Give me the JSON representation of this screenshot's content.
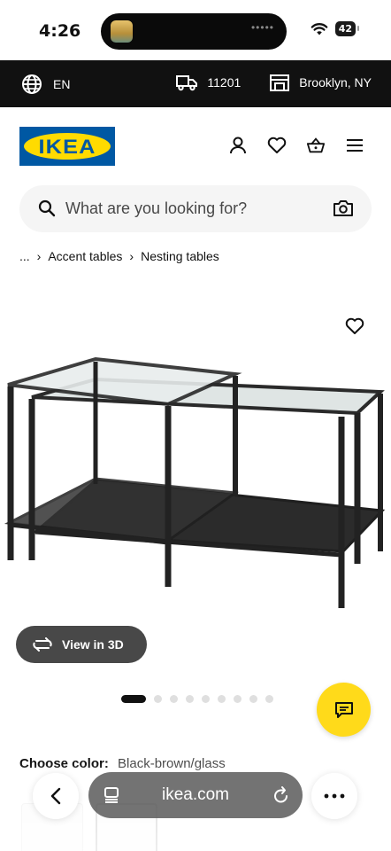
{
  "status_bar": {
    "time": "4:26",
    "battery": "42",
    "island_dots": "•••••"
  },
  "locale_bar": {
    "language": "EN",
    "zip": "11201",
    "store": "Brooklyn, NY"
  },
  "header": {
    "logo_text": "IKEA"
  },
  "search": {
    "placeholder": "What are you looking for?"
  },
  "breadcrumb": {
    "ellipsis": "...",
    "items": [
      "Accent tables",
      "Nesting tables"
    ]
  },
  "product": {
    "view_3d_label": "View in 3D",
    "image_count": 9,
    "active_image": 1
  },
  "color": {
    "label": "Choose color:",
    "value": "Black-brown/glass"
  },
  "browser": {
    "url": "ikea.com"
  },
  "colors": {
    "ikea_blue": "#0058a3",
    "ikea_yellow": "#ffdb00",
    "chat_yellow": "#ffda1a"
  }
}
